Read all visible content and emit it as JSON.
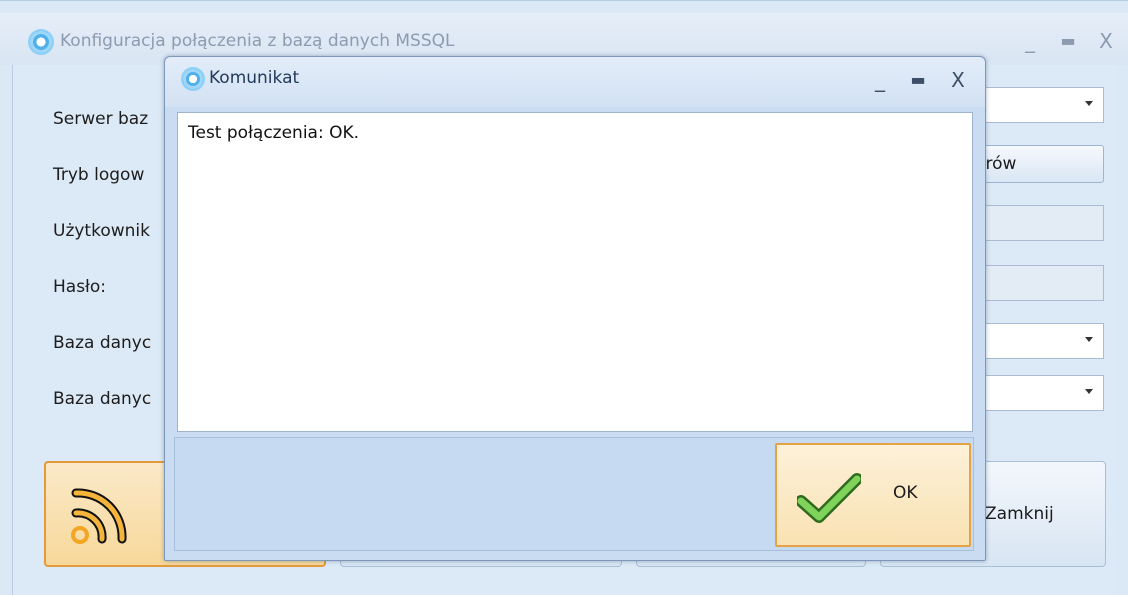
{
  "main_window": {
    "title": "Konfiguracja połączenia z bazą danych MSSQL",
    "controls": {
      "minimize": "_",
      "maximize": "▬",
      "close": "X"
    },
    "form": {
      "server_label": "Serwer baz",
      "login_mode_label": "Tryb logow",
      "user_label": "Użytkownik",
      "password_label": "Hasło:",
      "database1_label": "Baza danyc",
      "database2_label": "Baza danyc",
      "servers_button_label": "erów"
    },
    "close_button_label": "Zamknij"
  },
  "dialog": {
    "title": "Komunikat",
    "controls": {
      "minimize": "_",
      "maximize": "▬",
      "close": "X"
    },
    "message": "Test połączenia: OK.",
    "ok_label": "OK"
  },
  "icons": {
    "app": "app-icon",
    "check": "checkmark-icon",
    "test_connection": "rss-signal-icon"
  },
  "colors": {
    "window_bg": "#dbe8f6",
    "dialog_bg": "#c9dcf2",
    "active_border": "#e5a346",
    "check_green": "#6cc24a"
  }
}
